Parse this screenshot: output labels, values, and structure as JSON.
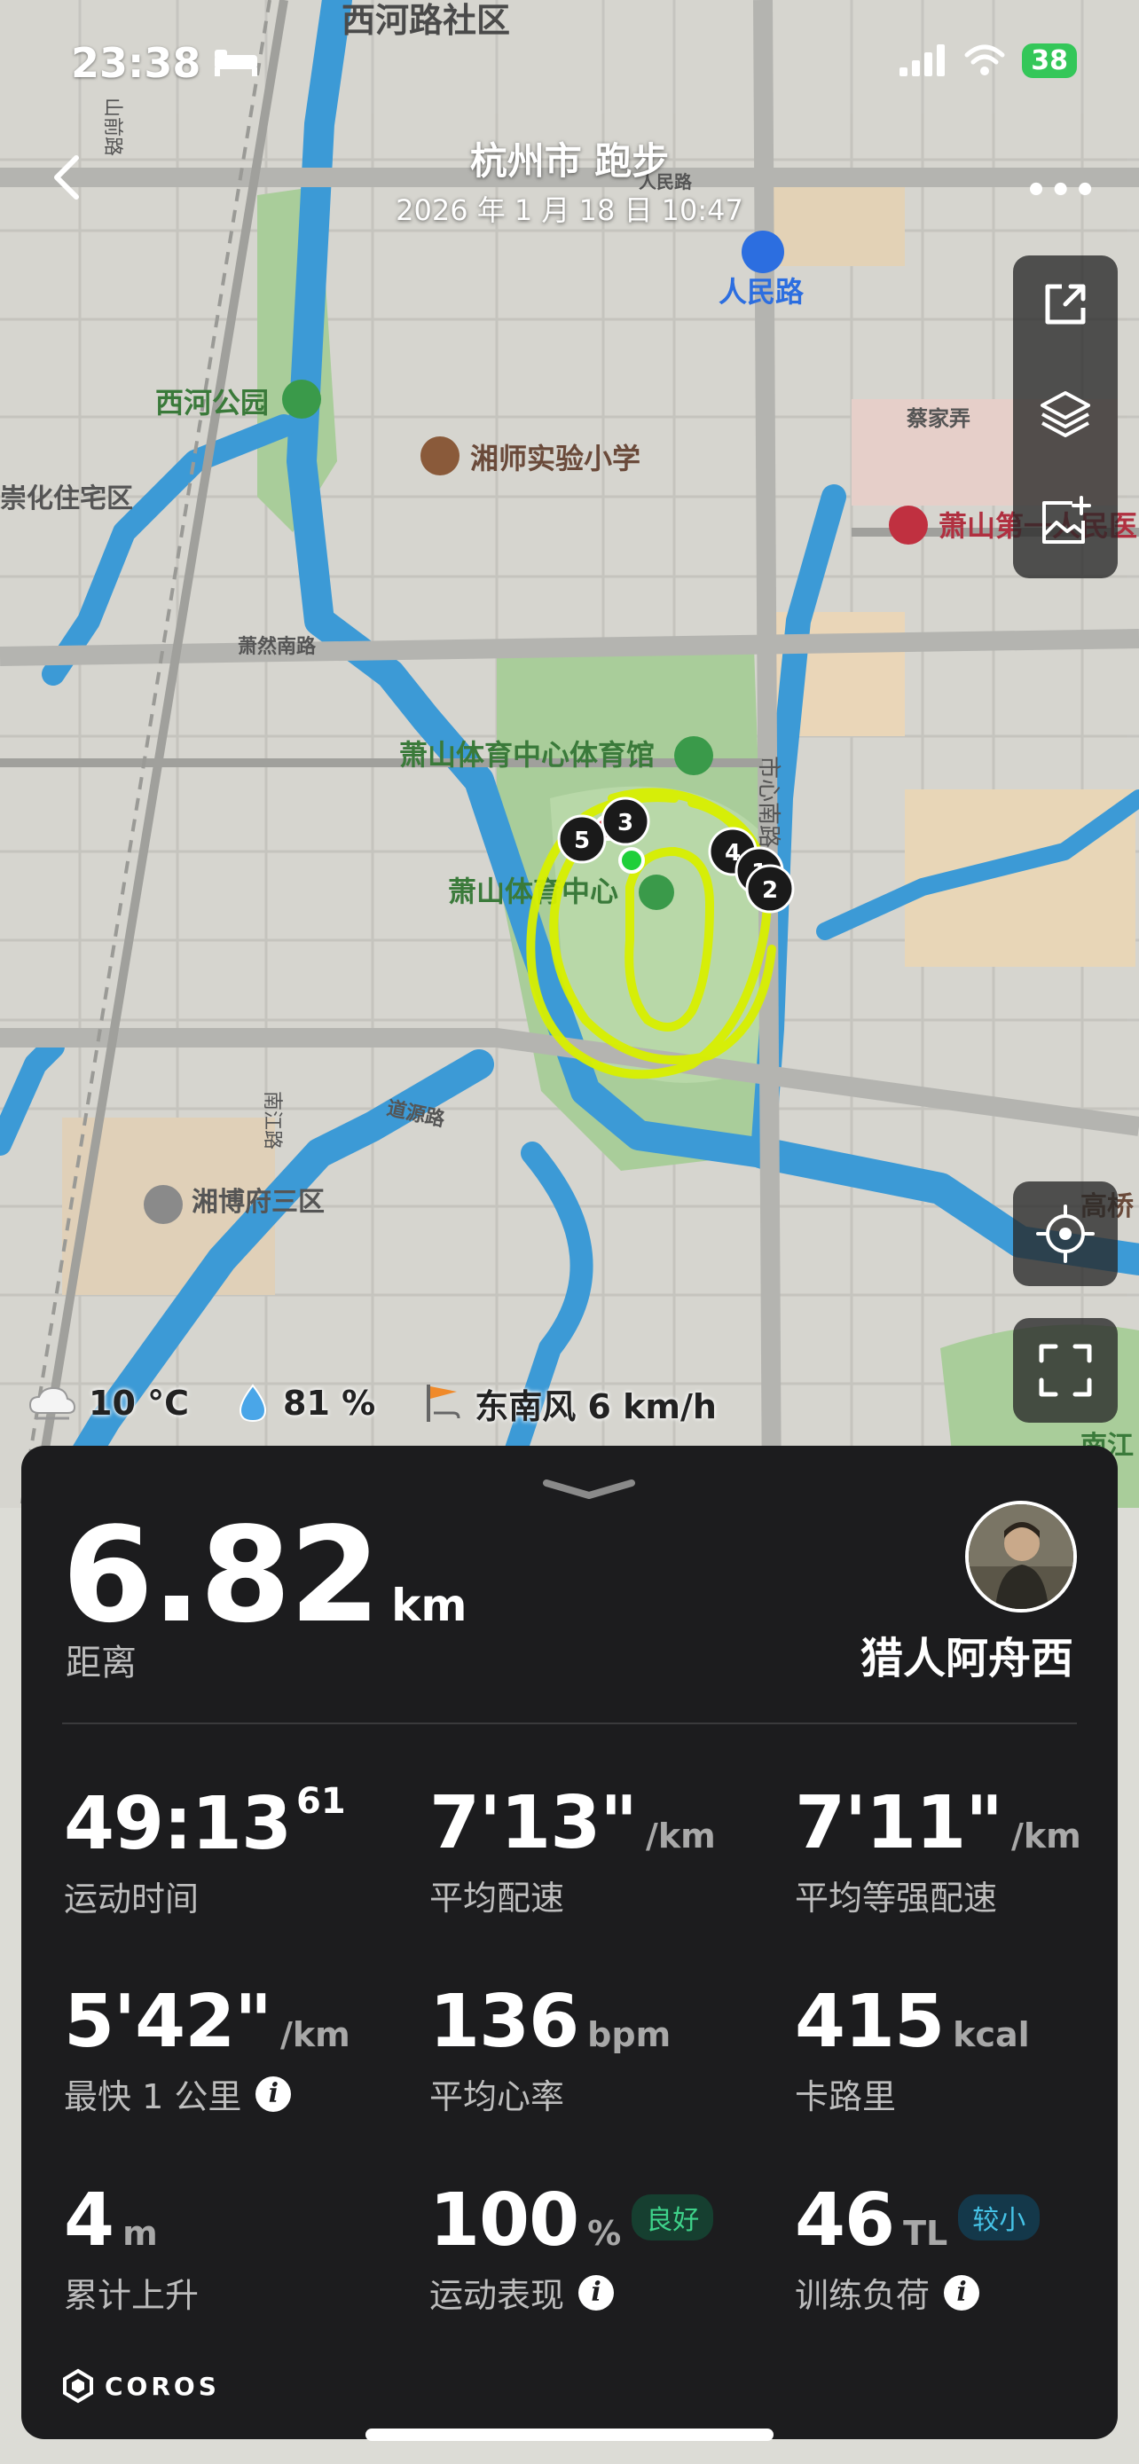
{
  "status_bar": {
    "time": "23:38",
    "battery": "38"
  },
  "header": {
    "title": "杭州市 跑步",
    "date": "2026 年 1 月 18 日 10:47"
  },
  "map": {
    "labels": {
      "xihe_community": "西河路社区",
      "renmin_road_metro": "人民路",
      "xihe_park": "西河公园",
      "xiangshi_school": "湘师实验小学",
      "caijia_lane": "蔡家弄",
      "chonghua_residence": "崇化住宅区",
      "xiaoshan_hospital": "萧山第一人民医",
      "xiaoran_south_road": "萧然南路",
      "gym": "萧山体育中心体育馆",
      "sports_center": "萧山体育中心",
      "city_center_south_road": "市心南路",
      "daoyuan_road": "道源路",
      "nanjiang_road": "南江路",
      "xiangbo_fu": "湘博府三区",
      "gaoqiao": "高桥",
      "nanjiang": "南江",
      "shanqian_road": "山前路",
      "renmin_small": "人民路",
      "hospital_short": "民医"
    },
    "km_markers": [
      "1",
      "2",
      "3",
      "4",
      "5"
    ]
  },
  "weather": {
    "temperature": "10 °C",
    "humidity": "81 %",
    "wind": "东南风 6 km/h"
  },
  "summary": {
    "distance_value": "6.82",
    "distance_unit": "km",
    "distance_label": "距离",
    "username": "猎人阿舟西"
  },
  "stats": [
    {
      "value": "49:13",
      "sup": "61",
      "unit": "",
      "label": "运动时间"
    },
    {
      "value": "7'13\"",
      "unit": "/km",
      "label": "平均配速"
    },
    {
      "value": "7'11\"",
      "unit": "/km",
      "label": "平均等强配速"
    },
    {
      "value": "5'42\"",
      "unit": "/km",
      "label": "最快 1 公里"
    },
    {
      "value": "136",
      "unit": "bpm",
      "label": "平均心率"
    },
    {
      "value": "415",
      "unit": "kcal",
      "label": "卡路里"
    },
    {
      "value": "4",
      "unit": "m",
      "label": "累计上升"
    },
    {
      "value": "100",
      "unit": "%",
      "label": "运动表现",
      "badge": "良好"
    },
    {
      "value": "46",
      "unit": "TL",
      "label": "训练负荷",
      "badge": "较小"
    }
  ],
  "brand": "COROS",
  "colors": {
    "track": "#d8f000",
    "panel": "#1c1c1e",
    "badge_green": "#3ed28a",
    "badge_blue": "#45c2e6",
    "water": "#3c9ad6"
  }
}
